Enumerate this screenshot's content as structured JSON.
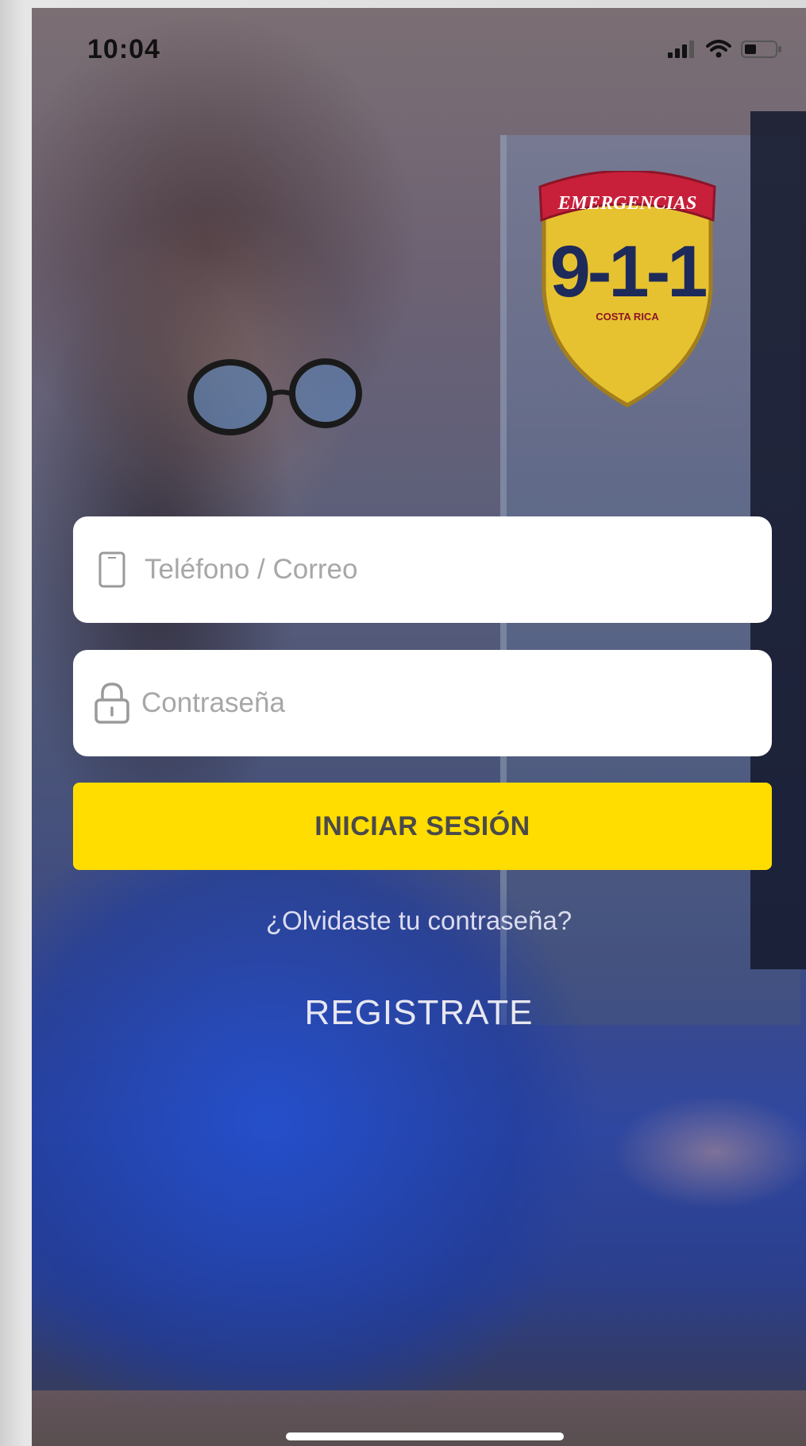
{
  "status_bar": {
    "time": "10:04",
    "icons": [
      "signal-icon",
      "wifi-icon",
      "battery-icon"
    ]
  },
  "logo": {
    "banner": "EMERGENCIAS",
    "number": "9-1-1",
    "country": "COSTA RICA",
    "colors": {
      "banner": "#c8203a",
      "shield": "#e3c12b",
      "text": "#1e2a5a"
    }
  },
  "form": {
    "phone_placeholder": "Teléfono / Correo",
    "password_placeholder": "Contraseña",
    "login_label": "INICIAR SESIÓN",
    "forgot_label": "¿Olvidaste tu contraseña?",
    "register_label": "REGISTRATE"
  },
  "colors": {
    "accent": "#ffdd00",
    "field_bg": "#ffffff"
  }
}
